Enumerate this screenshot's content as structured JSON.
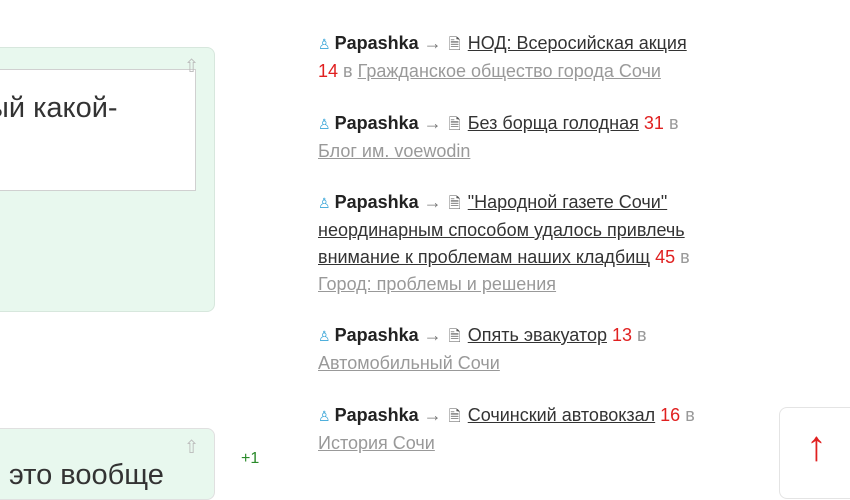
{
  "comments": {
    "top_text": "ый какой-",
    "bottom_text": "это вообще",
    "plus": "+1"
  },
  "feed": [
    {
      "user": "Papashka",
      "arrow": "→",
      "title": "НОД: Всеросийская акция",
      "count": "14",
      "in": "в",
      "blog": "Гражданское общество города Сочи"
    },
    {
      "user": "Papashka",
      "arrow": "→",
      "title": "Без борща голодная",
      "count": "31",
      "in": "в",
      "blog": "Блог им. voewodin"
    },
    {
      "user": "Papashka",
      "arrow": "→",
      "title_lines": [
        "\"Народной газете Сочи\"",
        "неординарным способом удалось привлечь",
        "внимание к проблемам наших кладбищ"
      ],
      "count": "45",
      "in": "в",
      "blog": "Город: проблемы и решения"
    },
    {
      "user": "Papashka",
      "arrow": "→",
      "title": "Опять эвакуатор",
      "count": "13",
      "in": "в",
      "blog": "Автомобильный Сочи"
    },
    {
      "user": "Papashka",
      "arrow": "→",
      "title": "Сочинский автовокзал",
      "count": "16",
      "in": "в",
      "blog": "История Сочи"
    }
  ],
  "scroll_top": {
    "label": "↑"
  },
  "icons": {
    "user": "user-icon",
    "doc": "document-icon",
    "up": "collapse-arrow-icon"
  }
}
